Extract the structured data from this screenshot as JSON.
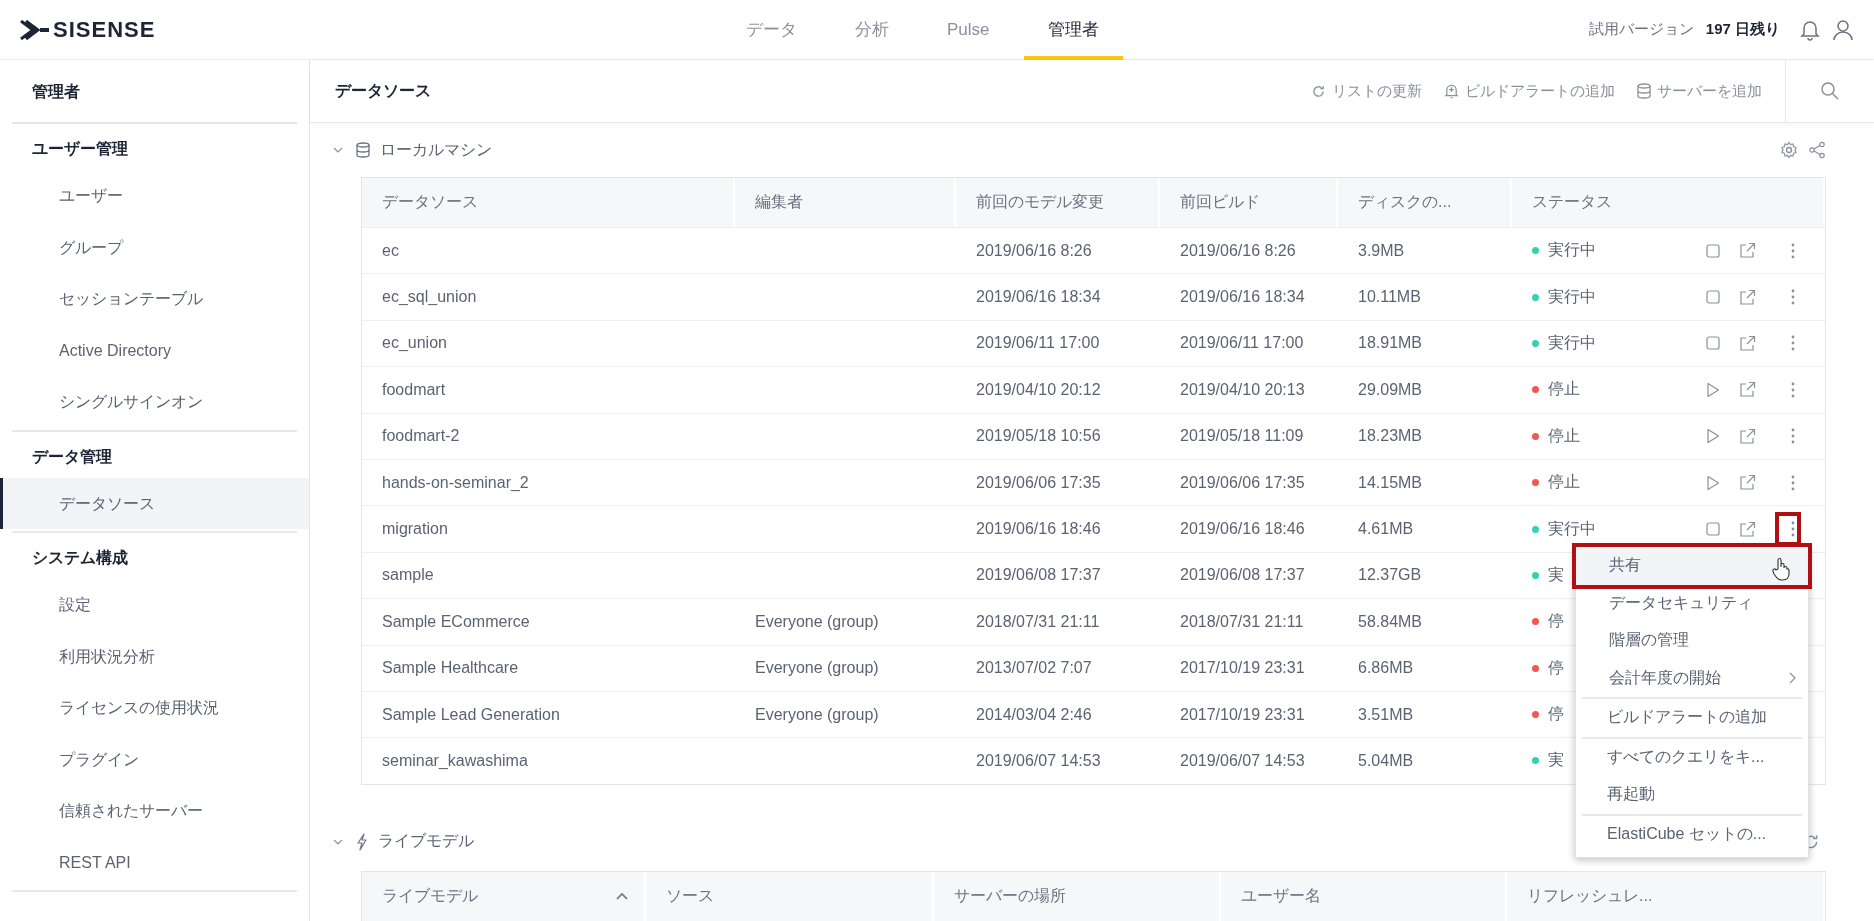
{
  "logo": "SISENSE",
  "nav": [
    {
      "label": "データ",
      "selected": false
    },
    {
      "label": "分析",
      "selected": false
    },
    {
      "label": "Pulse",
      "selected": false
    },
    {
      "label": "管理者",
      "selected": true
    }
  ],
  "trial": {
    "label": "試用バージョン",
    "days": "197 日残り"
  },
  "sidebar": {
    "title": "管理者",
    "groups": [
      {
        "heading": "ユーザー管理",
        "items": [
          {
            "label": "ユーザー",
            "selected": false
          },
          {
            "label": "グループ",
            "selected": false
          },
          {
            "label": "セッションテーブル",
            "selected": false
          },
          {
            "label": "Active Directory",
            "selected": false
          },
          {
            "label": "シングルサインオン",
            "selected": false
          }
        ]
      },
      {
        "heading": "データ管理",
        "items": [
          {
            "label": "データソース",
            "selected": true
          }
        ]
      },
      {
        "heading": "システム構成",
        "items": [
          {
            "label": "設定",
            "selected": false
          },
          {
            "label": "利用状況分析",
            "selected": false
          },
          {
            "label": "ライセンスの使用状況",
            "selected": false
          },
          {
            "label": "プラグイン",
            "selected": false
          },
          {
            "label": "信頼されたサーバー",
            "selected": false
          },
          {
            "label": "REST API",
            "selected": false
          }
        ]
      }
    ]
  },
  "header": {
    "title": "データソース",
    "actions": [
      {
        "label": "リストの更新",
        "kind": "refresh"
      },
      {
        "label": "ビルドアラートの追加",
        "kind": "alert"
      },
      {
        "label": "サーバーを追加",
        "kind": "server"
      }
    ]
  },
  "local_machine": {
    "title": "ローカルマシン",
    "expanded": true,
    "columns": [
      "データソース",
      "編集者",
      "前回のモデル変更",
      "前回ビルド",
      "ディスクの...",
      "ステータス"
    ],
    "rows": [
      {
        "name": "ec",
        "editor": "",
        "model_change": "2019/06/16 8:26",
        "build": "2019/06/16 8:26",
        "disk": "3.9MB",
        "status": "実行中",
        "color": "#33d1b4",
        "actions_shown": true,
        "running": true,
        "menu_annotated": false
      },
      {
        "name": "ec_sql_union",
        "editor": "",
        "model_change": "2019/06/16 18:34",
        "build": "2019/06/16 18:34",
        "disk": "10.11MB",
        "status": "実行中",
        "color": "#33d1b4",
        "actions_shown": true,
        "running": true,
        "menu_annotated": false
      },
      {
        "name": "ec_union",
        "editor": "",
        "model_change": "2019/06/11 17:00",
        "build": "2019/06/11 17:00",
        "disk": "18.91MB",
        "status": "実行中",
        "color": "#33d1b4",
        "actions_shown": true,
        "running": true,
        "menu_annotated": false
      },
      {
        "name": "foodmart",
        "editor": "",
        "model_change": "2019/04/10 20:12",
        "build": "2019/04/10 20:13",
        "disk": "29.09MB",
        "status": "停止",
        "color": "#f25656",
        "actions_shown": true,
        "running": false,
        "menu_annotated": false
      },
      {
        "name": "foodmart-2",
        "editor": "",
        "model_change": "2019/05/18 10:56",
        "build": "2019/05/18 11:09",
        "disk": "18.23MB",
        "status": "停止",
        "color": "#f25656",
        "actions_shown": true,
        "running": false,
        "menu_annotated": false
      },
      {
        "name": "hands-on-seminar_2",
        "editor": "",
        "model_change": "2019/06/06 17:35",
        "build": "2019/06/06 17:35",
        "disk": "14.15MB",
        "status": "停止",
        "color": "#f25656",
        "actions_shown": true,
        "running": false,
        "menu_annotated": false
      },
      {
        "name": "migration",
        "editor": "",
        "model_change": "2019/06/16 18:46",
        "build": "2019/06/16 18:46",
        "disk": "4.61MB",
        "status": "実行中",
        "color": "#33d1b4",
        "actions_shown": true,
        "running": true,
        "menu_annotated": true
      },
      {
        "name": "sample",
        "editor": "",
        "model_change": "2019/06/08 17:37",
        "build": "2019/06/08 17:37",
        "disk": "12.37GB",
        "status": "実",
        "color": "#33d1b4"
      },
      {
        "name": "Sample ECommerce",
        "editor": "Everyone (group)",
        "model_change": "2018/07/31 21:11",
        "build": "2018/07/31 21:11",
        "disk": "58.84MB",
        "status": "停",
        "color": "#f25656"
      },
      {
        "name": "Sample Healthcare",
        "editor": "Everyone (group)",
        "model_change": "2013/07/02 7:07",
        "build": "2017/10/19 23:31",
        "disk": "6.86MB",
        "status": "停",
        "color": "#f25656"
      },
      {
        "name": "Sample Lead Generation",
        "editor": "Everyone (group)",
        "model_change": "2014/03/04 2:46",
        "build": "2017/10/19 23:31",
        "disk": "3.51MB",
        "status": "停",
        "color": "#f25656"
      },
      {
        "name": "seminar_kawashima",
        "editor": "",
        "model_change": "2019/06/07 14:53",
        "build": "2019/06/07 14:53",
        "disk": "5.04MB",
        "status": "実",
        "color": "#33d1b4"
      }
    ]
  },
  "menu": {
    "groups": [
      [
        {
          "label": "共有",
          "selected": true,
          "annotated": true,
          "submenu": false
        },
        {
          "label": "データセキュリティ",
          "selected": false,
          "annotated": false,
          "submenu": false
        },
        {
          "label": "階層の管理",
          "selected": false,
          "annotated": false,
          "submenu": false
        },
        {
          "label": "会計年度の開始",
          "selected": false,
          "annotated": false,
          "submenu": true
        }
      ],
      [
        {
          "label": "ビルドアラートの追加",
          "selected": false,
          "annotated": false,
          "submenu": false
        }
      ],
      [
        {
          "label": "すべてのクエリをキ...",
          "selected": false,
          "annotated": false,
          "submenu": false
        },
        {
          "label": "再起動",
          "selected": false,
          "annotated": false,
          "submenu": false
        }
      ],
      [
        {
          "label": "ElastiCube セットの...",
          "selected": false,
          "annotated": false,
          "submenu": false
        }
      ]
    ]
  },
  "live_models": {
    "title": "ライブモデル",
    "expanded": true,
    "columns": [
      {
        "label": "ライブモデル",
        "sorted_ascending": true
      },
      {
        "label": "ソース"
      },
      {
        "label": "サーバーの場所"
      },
      {
        "label": "ユーザー名"
      },
      {
        "label": "リフレッシュレ..."
      }
    ]
  }
}
